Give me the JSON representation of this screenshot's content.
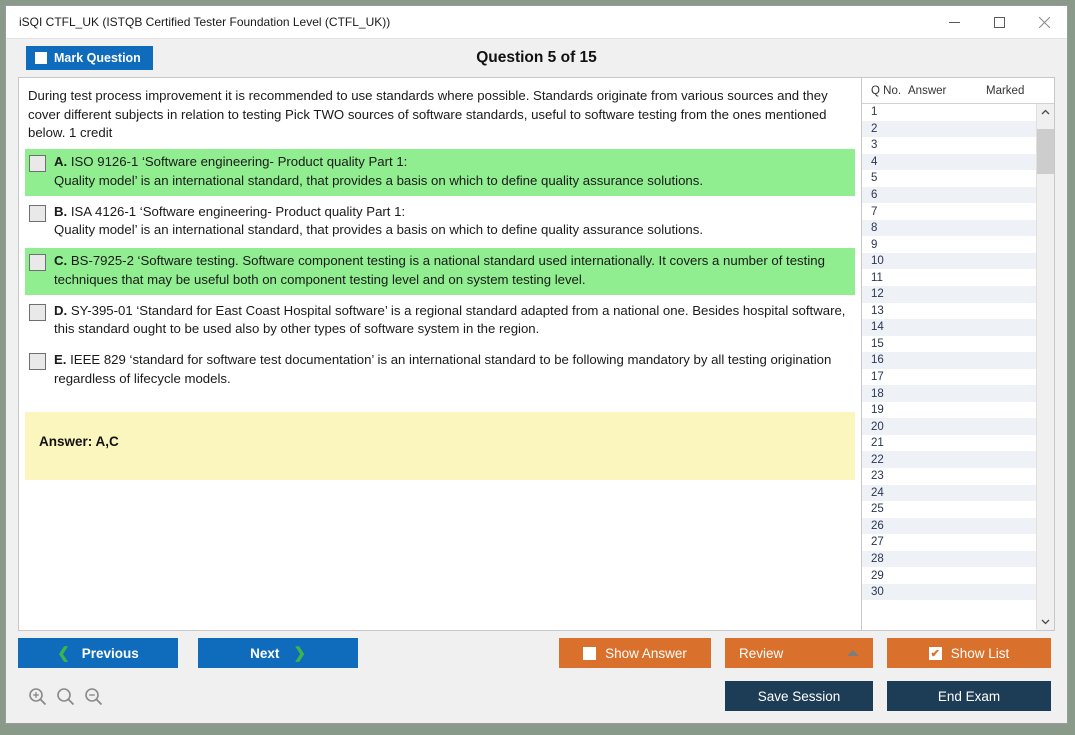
{
  "window": {
    "title": "iSQI CTFL_UK (ISTQB Certified Tester Foundation Level (CTFL_UK))",
    "minimize_label": "—",
    "maximize_label": "□",
    "close_label": "✕"
  },
  "header": {
    "mark_button_label": "Mark Question",
    "question_title": "Question 5 of 15"
  },
  "question": {
    "text": "During test process improvement it is recommended to use standards where possible. Standards originate from various sources and they cover different subjects in relation to testing Pick TWO sources of software standards, useful to software testing from the ones mentioned below. 1 credit",
    "options": [
      {
        "letter": "A.",
        "text": "ISO 9126-1 ‘Software engineering- Product quality Part 1:\nQuality model’ is an international standard, that provides a basis on which to define quality assurance solutions.",
        "highlighted": true
      },
      {
        "letter": "B.",
        "text": "ISA 4126-1 ‘Software engineering- Product quality Part 1:\nQuality model’ is an international standard, that provides a basis on which to define quality assurance solutions.",
        "highlighted": false
      },
      {
        "letter": "C.",
        "text": "BS-7925-2 ‘Software testing. Software component testing is a national standard used internationally. It covers a number of testing techniques that may be useful both on component testing level and on system testing level.",
        "highlighted": true
      },
      {
        "letter": "D.",
        "text": "SY-395-01 ‘Standard for East Coast Hospital software’ is a regional standard adapted from a national one. Besides hospital software, this standard ought to be used also by other types of software system in the region.",
        "highlighted": false
      },
      {
        "letter": "E.",
        "text": "IEEE 829 ‘standard for software test documentation’ is an international standard to be following mandatory by all testing origination regardless of lifecycle models.",
        "highlighted": false
      }
    ],
    "answer_label": "Answer: A,C"
  },
  "question_list": {
    "columns": [
      "Q No.",
      "Answer",
      "Marked"
    ],
    "rows": [
      {
        "no": "1",
        "answer": "",
        "marked": ""
      },
      {
        "no": "2",
        "answer": "",
        "marked": ""
      },
      {
        "no": "3",
        "answer": "",
        "marked": ""
      },
      {
        "no": "4",
        "answer": "",
        "marked": ""
      },
      {
        "no": "5",
        "answer": "",
        "marked": ""
      },
      {
        "no": "6",
        "answer": "",
        "marked": ""
      },
      {
        "no": "7",
        "answer": "",
        "marked": ""
      },
      {
        "no": "8",
        "answer": "",
        "marked": ""
      },
      {
        "no": "9",
        "answer": "",
        "marked": ""
      },
      {
        "no": "10",
        "answer": "",
        "marked": ""
      },
      {
        "no": "11",
        "answer": "",
        "marked": ""
      },
      {
        "no": "12",
        "answer": "",
        "marked": ""
      },
      {
        "no": "13",
        "answer": "",
        "marked": ""
      },
      {
        "no": "14",
        "answer": "",
        "marked": ""
      },
      {
        "no": "15",
        "answer": "",
        "marked": ""
      },
      {
        "no": "16",
        "answer": "",
        "marked": ""
      },
      {
        "no": "17",
        "answer": "",
        "marked": ""
      },
      {
        "no": "18",
        "answer": "",
        "marked": ""
      },
      {
        "no": "19",
        "answer": "",
        "marked": ""
      },
      {
        "no": "20",
        "answer": "",
        "marked": ""
      },
      {
        "no": "21",
        "answer": "",
        "marked": ""
      },
      {
        "no": "22",
        "answer": "",
        "marked": ""
      },
      {
        "no": "23",
        "answer": "",
        "marked": ""
      },
      {
        "no": "24",
        "answer": "",
        "marked": ""
      },
      {
        "no": "25",
        "answer": "",
        "marked": ""
      },
      {
        "no": "26",
        "answer": "",
        "marked": ""
      },
      {
        "no": "27",
        "answer": "",
        "marked": ""
      },
      {
        "no": "28",
        "answer": "",
        "marked": ""
      },
      {
        "no": "29",
        "answer": "",
        "marked": ""
      },
      {
        "no": "30",
        "answer": "",
        "marked": ""
      }
    ],
    "scroll_up_label": "⌃",
    "scroll_down_label": "⌄"
  },
  "footer": {
    "previous_label": "Previous",
    "next_label": "Next",
    "previous_chevron": "❮",
    "next_chevron": "❯",
    "show_answer_label": "Show Answer",
    "show_answer_checked": false,
    "review_label": "Review",
    "show_list_label": "Show List",
    "show_list_checked": true,
    "show_list_check_glyph": "✔",
    "save_session_label": "Save Session",
    "end_exam_label": "End Exam"
  },
  "colors": {
    "primary_blue": "#0f6cbd",
    "orange": "#d9702b",
    "dark_navy": "#1d3c56",
    "highlight_green": "#90ee90",
    "answer_yellow": "#fbf6bd",
    "chevron_green": "#3cb54a"
  }
}
